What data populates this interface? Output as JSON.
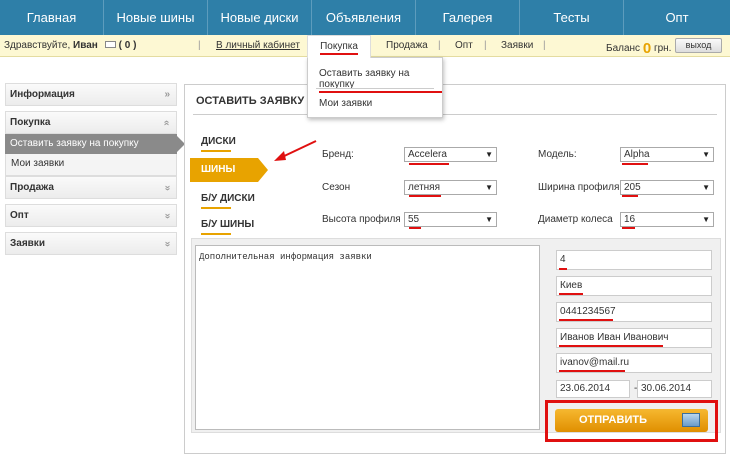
{
  "nav": {
    "items": [
      "Главная",
      "Новые шины",
      "Новые диски",
      "Объявления",
      "Галерея",
      "Тесты",
      "Опт"
    ]
  },
  "subbar": {
    "greeting_prefix": "Здравствуйте,",
    "user_name": "Иван",
    "messages": "( 0 )",
    "cabinet_link": "В личный кабинет",
    "menu": [
      "Покупка",
      "Продажа",
      "Опт",
      "Заявки"
    ],
    "balance_label": "Баланс",
    "balance_value": "0",
    "currency": "грн.",
    "exit_label": "выход"
  },
  "dropdown": {
    "items": [
      "Оставить заявку на покупку",
      "Мои заявки"
    ]
  },
  "sidebar": {
    "informacia": "Информация",
    "pokupka": "Покупка",
    "pokupka_active": "Оставить заявку на покупку",
    "pokupka_sub": "Мои заявки",
    "prodazha": "Продажа",
    "opt": "Опт",
    "zayavki": "Заявки"
  },
  "panel": {
    "title": "ОСТАВИТЬ ЗАЯВКУ НА",
    "categories": [
      "ДИСКИ",
      "ШИНЫ",
      "Б/У ДИСКИ",
      "Б/У ШИНЫ"
    ],
    "active_category": "ШИНЫ",
    "fields": {
      "brand_label": "Бренд:",
      "brand_value": "Accelera",
      "model_label": "Модель:",
      "model_value": "Alpha",
      "season_label": "Сезон",
      "season_value": "летняя",
      "width_label": "Ширина профиля",
      "width_value": "205",
      "height_label": "Высота профиля",
      "height_value": "55",
      "diameter_label": "Диаметр колеса",
      "diameter_value": "16"
    },
    "textarea_placeholder": "Дополнительная информация заявки",
    "inputs": {
      "quantity": "4",
      "city": "Киев",
      "phone": "0441234567",
      "name": "Иванов Иван Иванович",
      "email": "ivanov@mail.ru",
      "date_from": "23.06.2014",
      "date_to": "30.06.2014"
    },
    "submit_label": "ОТПРАВИТЬ"
  },
  "colors": {
    "nav_bg": "#2e7fa8",
    "accent": "#e8a300",
    "highlight": "#e01010",
    "subbar_bg": "#fdf8d3"
  }
}
